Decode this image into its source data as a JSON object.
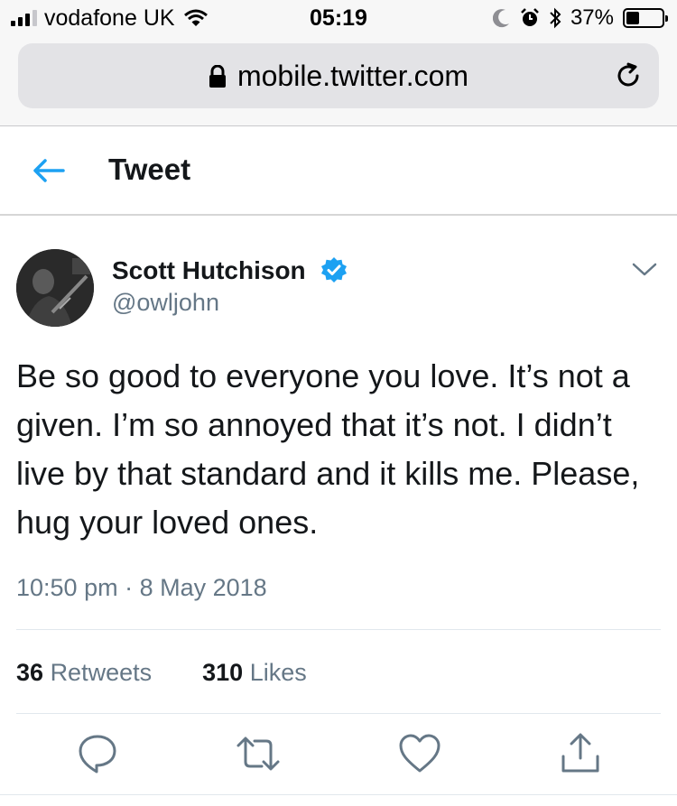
{
  "status_bar": {
    "carrier": "vodafone UK",
    "time": "05:19",
    "battery_percent": "37%",
    "battery_level": 0.37,
    "signal_bars_on": 3,
    "icons": [
      "signal-icon",
      "wifi-icon",
      "moon-icon",
      "alarm-icon",
      "bluetooth-icon",
      "battery-icon"
    ]
  },
  "browser": {
    "url": "mobile.twitter.com",
    "icons": [
      "lock-icon",
      "reload-icon"
    ]
  },
  "header": {
    "title": "Tweet",
    "back_icon": "back-arrow-icon"
  },
  "tweet": {
    "author_name": "Scott Hutchison",
    "handle": "@owljohn",
    "verified": true,
    "text": "Be so good to everyone you love. It’s not a given. I’m so annoyed that it’s not. I didn’t live by that standard and it kills me. Please, hug your loved ones.",
    "timestamp": "10:50 pm · 8 May 2018",
    "retweets_count": "36",
    "retweets_label": "Retweets",
    "likes_count": "310",
    "likes_label": "Likes"
  },
  "actions": [
    "reply-icon",
    "retweet-icon",
    "like-icon",
    "share-icon"
  ],
  "colors": {
    "twitter_blue": "#1da1f2",
    "secondary_text": "#657786",
    "primary_text": "#14171a"
  }
}
